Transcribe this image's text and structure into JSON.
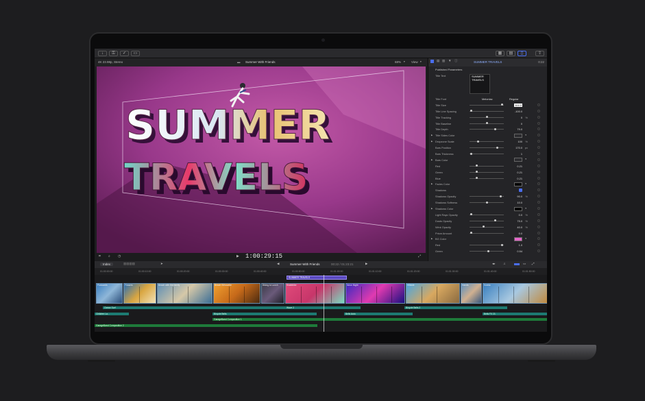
{
  "viewer": {
    "format": "4K 23.98p, Stereo",
    "project": "Summer With Friends",
    "zoom": "68%",
    "view": "View",
    "timecode": "1:00:29:15",
    "title_line1": "SUMMER",
    "title_line2": "TRAVELS"
  },
  "inspector": {
    "header": "SUMMER TRAVELS",
    "duration": "0:22",
    "section": "Published Parameters",
    "title_text_label": "Title Text",
    "title_text_value": "SUMMER TRAVELS",
    "title_font_label": "Title Font",
    "font_name": "Melonlac",
    "font_style": "Regular",
    "params": [
      {
        "label": "Title Size",
        "value": "300.0",
        "pos": 0.95,
        "highlight": true
      },
      {
        "label": "Title Line Spacing",
        "value": "-100.0",
        "pos": 0.05
      },
      {
        "label": "Title Tracking",
        "value": "0",
        "unit": "%",
        "pos": 0.5
      },
      {
        "label": "Title Baseline",
        "value": "0",
        "pos": 0.5
      },
      {
        "label": "Title Depth",
        "value": "79.0",
        "pos": 0.75
      },
      {
        "label": "Title Sides Color",
        "swatch": "#2b2b2f",
        "tri": true
      },
      {
        "label": "Dropzone Scale",
        "value": "100",
        "unit": "%",
        "pos": 0.25,
        "tri": true
      },
      {
        "label": "Bars Position",
        "value": "170.0",
        "unit": "px",
        "pos": 0.8
      },
      {
        "label": "Bars Thickness",
        "value": "1",
        "pos": 0.05
      },
      {
        "label": "Bars Color",
        "swatch": "#2b2b2f",
        "tri": true
      },
      {
        "label": "Red",
        "value": "0.21",
        "pos": 0.21
      },
      {
        "label": "Green",
        "value": "0.21",
        "pos": 0.21
      },
      {
        "label": "Blue",
        "value": "0.21",
        "pos": 0.21
      },
      {
        "label": "Fades Color",
        "swatch": "#050505",
        "tri": true
      },
      {
        "label": "Shadows",
        "check": true
      },
      {
        "label": "Shadows Opacity",
        "value": "90.0",
        "unit": "%",
        "pos": 0.9
      },
      {
        "label": "Shadows Softness",
        "value": "10.0",
        "pos": 0.5
      },
      {
        "label": "Shadows Color",
        "swatch": "#050505",
        "tri": true
      },
      {
        "label": "Light Rays Opacity",
        "value": "0.0",
        "unit": "%",
        "pos": 0.05
      },
      {
        "label": "Dusts Opacity",
        "value": "75.0",
        "unit": "%",
        "pos": 0.75
      },
      {
        "label": "Wink Opacity",
        "value": "40.0",
        "unit": "%",
        "pos": 0.4
      },
      {
        "label": "Prism Amount",
        "value": "0.0",
        "pos": 0.05
      },
      {
        "label": "BG Color",
        "swatch": "#e466c9",
        "tri": true
      },
      {
        "label": "Red",
        "value": "1.0",
        "pos": 0.95
      },
      {
        "label": "Green",
        "value": "0.54",
        "pos": 0.54
      }
    ]
  },
  "timeline": {
    "index": "Index",
    "project": "Summer With Friends",
    "time": "00:22 / 01:23:21",
    "title_clip": "SUMMER TRAVELS",
    "ruler": [
      "01:00:00:00",
      "01:00:10:00",
      "01:00:20:00",
      "01:00:30:00",
      "01:00:40:00",
      "01:00:50:00",
      "01:01:00:00",
      "01:01:10:00",
      "01:01:20:00",
      "01:01:30:00",
      "01:01:40:00",
      "01:01:50:00"
    ],
    "clips": [
      {
        "name": "Postcards",
        "w": 40,
        "colors": [
          "#3a7fc0",
          "#8fb7d8",
          "#2b4e7a"
        ]
      },
      {
        "name": "Flowers",
        "w": 49,
        "colors": [
          "#2a6fb5",
          "#d9a640",
          "#f2e2b8"
        ]
      },
      {
        "name": "Beach with the family",
        "w": 82,
        "colors": [
          "#5f8fb5",
          "#d6c8a8",
          "#3b6e96"
        ]
      },
      {
        "name": "Beach Silhouette",
        "w": 70,
        "colors": [
          "#f0a030",
          "#c76a1a",
          "#4a2a10"
        ]
      },
      {
        "name": "Biking to Lunch",
        "w": 35,
        "colors": [
          "#3c3c48",
          "#6a5a7a",
          "#202028"
        ]
      },
      {
        "name": "Skatebike",
        "w": 88,
        "colors": [
          "#e04a7a",
          "#c7366a",
          "#7adbc0"
        ]
      },
      {
        "name": "Neon Night",
        "w": 88,
        "colors": [
          "#3a2ac0",
          "#e03ab0",
          "#1a1080"
        ]
      },
      {
        "name": "Hillside",
        "w": 80,
        "colors": [
          "#4aa6e0",
          "#d8a860",
          "#8a6a40"
        ]
      },
      {
        "name": "Hands",
        "w": 32,
        "colors": [
          "#5a90c0",
          "#d0b090",
          "#3a5a80"
        ]
      },
      {
        "name": "Scenic",
        "w": 96,
        "colors": [
          "#3a80c0",
          "#a8c8e0",
          "#c08a40"
        ]
      }
    ],
    "bars": [
      {
        "label": "Ocean Surf",
        "l": 12,
        "t": 46,
        "w": 290,
        "color": "#1d7a72"
      },
      {
        "label": "Wave 2",
        "l": 278,
        "t": 46,
        "w": 110,
        "color": "#1d7a72"
      },
      {
        "label": "Bicycle Bells 2",
        "l": 452,
        "t": 46,
        "w": 150,
        "color": "#1d7a72"
      },
      {
        "label": "Children La...",
        "l": 0,
        "t": 55,
        "w": 50,
        "color": "#1d7a72"
      },
      {
        "label": "Bicycle Bells",
        "l": 172,
        "t": 55,
        "w": 152,
        "color": "#1d7a72"
      },
      {
        "label": "Bells Auto",
        "l": 364,
        "t": 55,
        "w": 100,
        "color": "#1d7a72"
      },
      {
        "label": "Bells FX 21",
        "l": 566,
        "t": 55,
        "w": 94,
        "color": "#1d7a72"
      },
      {
        "label": "GarageBand Composition 1",
        "l": 172,
        "t": 63,
        "w": 488,
        "color": "#1e7a3a"
      },
      {
        "label": "GarageBand Composition 2",
        "l": 0,
        "t": 72,
        "w": 325,
        "color": "#1e7a3a"
      }
    ]
  }
}
